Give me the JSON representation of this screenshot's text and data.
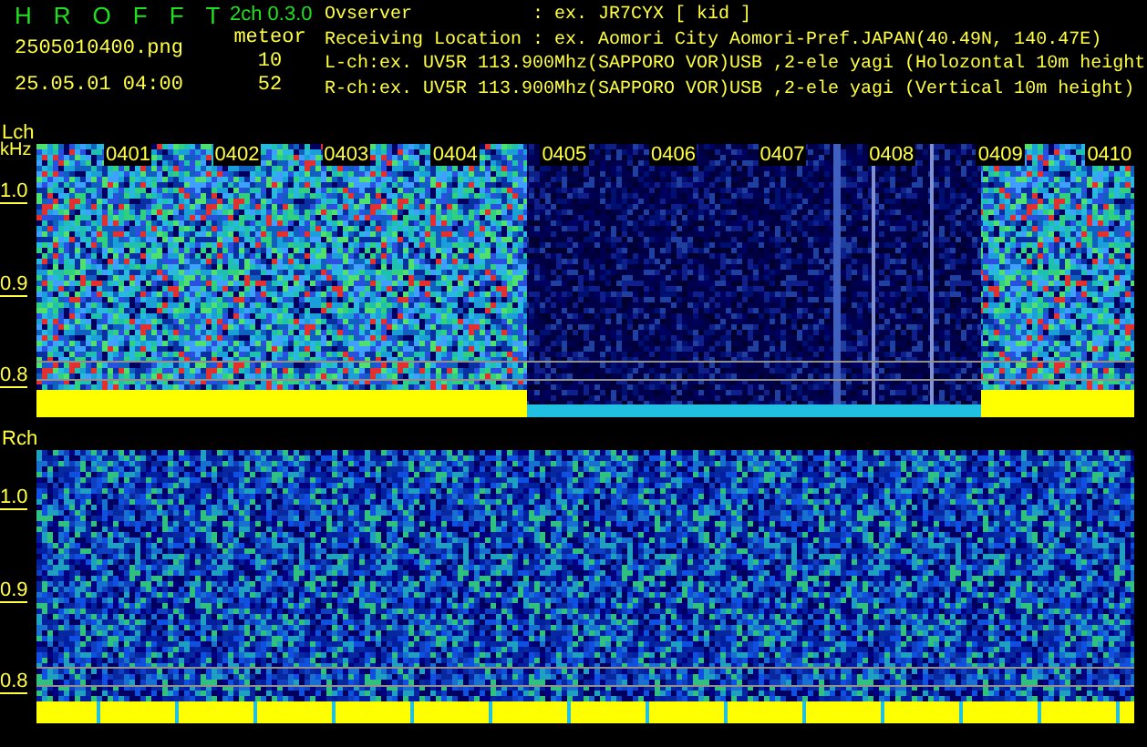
{
  "header": {
    "app_title": "HROFFT",
    "version": "2ch 0.3.0",
    "filename": "2505010400.png",
    "datetime": "25.05.01 04:00",
    "meteor_label": "meteor",
    "meteor_counts": [
      "10",
      "52"
    ],
    "info_lines": [
      "Ovserver           : ex. JR7CYX [ kid ]",
      "Receiving Location : ex. Aomori City Aomori-Pref.JAPAN(40.49N, 140.47E)",
      "L-ch:ex. UV5R 113.900Mhz(SAPPORO VOR)USB ,2-ele yagi (Holozontal 10m height",
      "R-ch:ex. UV5R 113.900Mhz(SAPPORO VOR)USB ,2-ele yagi (Vertical 10m height)"
    ]
  },
  "panels": [
    {
      "name": "Lch",
      "unit": "kHz",
      "ticks": [
        "1.0",
        "0.9",
        "0.8"
      ],
      "time_labels": [
        "0401",
        "0402",
        "0403",
        "0404",
        "0405",
        "0406",
        "0407",
        "0408",
        "0409",
        "0410"
      ]
    },
    {
      "name": "Rch",
      "ticks": [
        "1.0",
        "0.9",
        "0.8"
      ]
    }
  ]
}
